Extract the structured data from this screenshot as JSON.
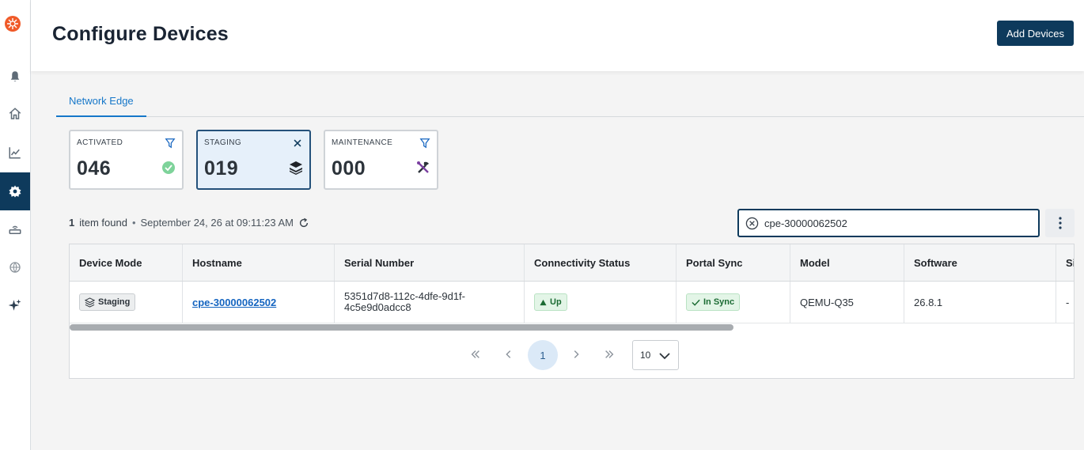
{
  "header": {
    "title": "Configure Devices",
    "add_button_label": "Add Devices"
  },
  "sidebar": {
    "logo": "brand-logo",
    "items": [
      {
        "icon": "bell-icon"
      },
      {
        "icon": "home-icon"
      },
      {
        "icon": "chart-icon"
      },
      {
        "icon": "gear-icon",
        "active": true
      },
      {
        "icon": "router-icon"
      },
      {
        "icon": "globe-icon"
      },
      {
        "icon": "sparkle-icon"
      }
    ]
  },
  "tabs": [
    {
      "label": "Network Edge",
      "active": true
    }
  ],
  "status_cards": [
    {
      "label": "ACTIVATED",
      "value": "046",
      "action_icon": "filter-icon",
      "icon": "check-circle-icon",
      "selected": false
    },
    {
      "label": "STAGING",
      "value": "019",
      "action_icon": "close-icon",
      "icon": "layers-icon",
      "selected": true
    },
    {
      "label": "MAINTENANCE",
      "value": "000",
      "action_icon": "filter-icon",
      "icon": "tools-icon",
      "selected": false
    }
  ],
  "results": {
    "count": "1",
    "text": "item found",
    "timestamp": "September 24, 26 at 09:11:23 AM"
  },
  "search": {
    "value": "cpe-30000062502"
  },
  "table": {
    "columns": [
      "Device Mode",
      "Hostname",
      "Serial Number",
      "Connectivity Status",
      "Portal Sync",
      "Model",
      "Software",
      "Si"
    ],
    "rows": [
      {
        "device_mode": "Staging",
        "hostname": "cpe-30000062502",
        "serial_number": "5351d7d8-112c-4dfe-9d1f-4c5e9d0adcc8",
        "connectivity_status": "Up",
        "portal_sync": "In Sync",
        "model": "QEMU-Q35",
        "software": "26.8.1",
        "si": "-"
      }
    ]
  },
  "pagination": {
    "current_page": "1",
    "page_size": "10"
  },
  "colors": {
    "primary": "#0e3a5c",
    "link": "#1565c0",
    "success": "#1b6b33",
    "active_tab": "#1677c9"
  }
}
